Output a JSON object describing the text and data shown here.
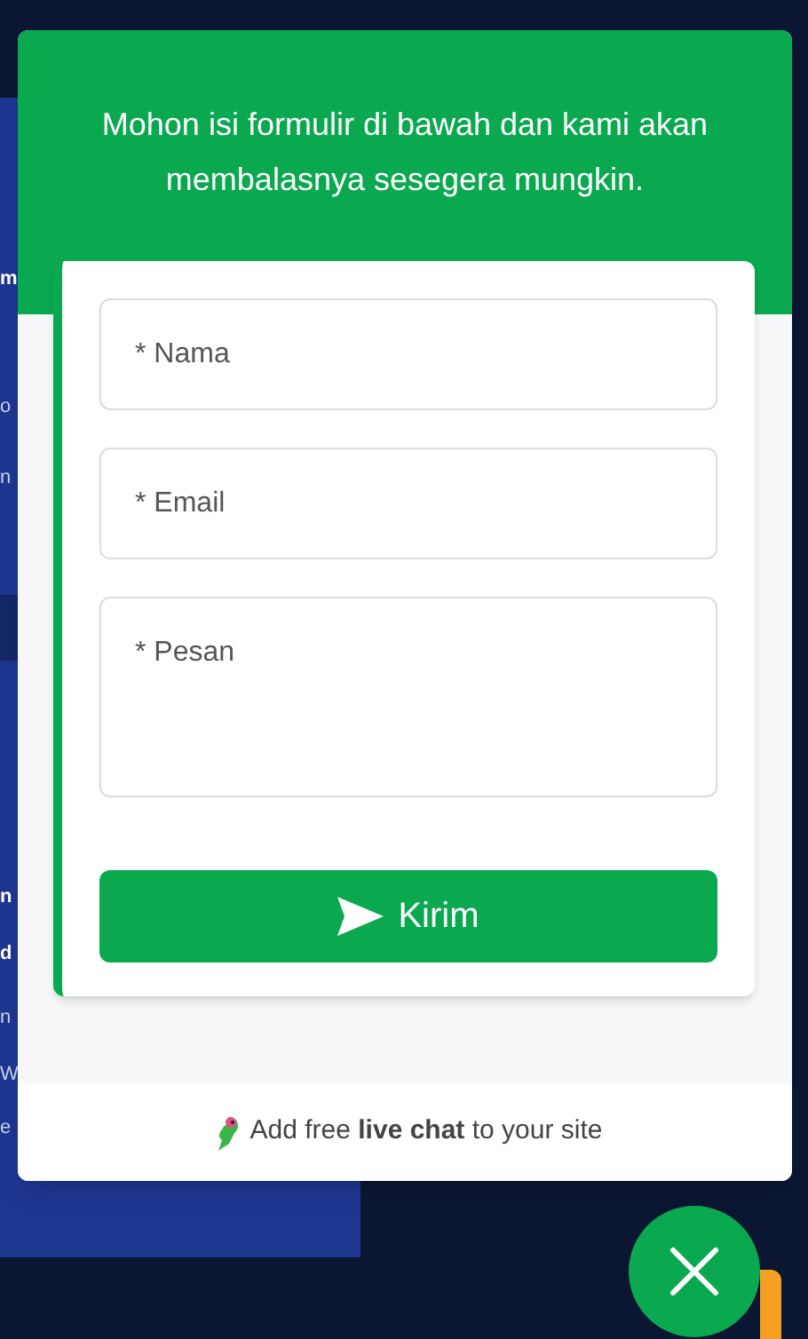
{
  "background_fragments": [
    {
      "text": "m",
      "bold": true
    },
    {
      "text": "o",
      "bold": false
    },
    {
      "text": "n",
      "bold": false
    },
    {
      "text": "n",
      "bold": true
    },
    {
      "text": "d",
      "bold": true
    },
    {
      "text": "n",
      "bold": false
    },
    {
      "text": "W",
      "bold": false
    },
    {
      "text": "e",
      "bold": false
    }
  ],
  "header": {
    "message": "Mohon isi formulir di bawah dan kami akan membalasnya sesegera mungkin."
  },
  "form": {
    "fields": [
      {
        "kind": "input",
        "placeholder": "* Nama"
      },
      {
        "kind": "input",
        "placeholder": "* Email"
      },
      {
        "kind": "textarea",
        "placeholder": "* Pesan"
      }
    ],
    "submit": {
      "label": "Kirim"
    }
  },
  "footer": {
    "text": "Add free **live chat** to your site"
  }
}
